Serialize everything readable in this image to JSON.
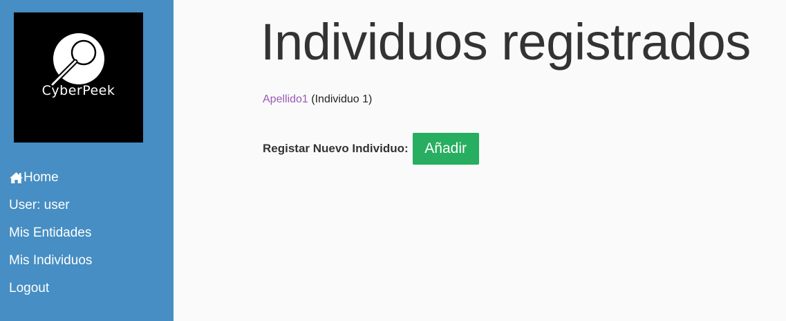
{
  "sidebar": {
    "logo": {
      "text": "CyberPeek",
      "icon": "magnifier-icon"
    },
    "items": [
      {
        "label": "Home",
        "icon": "home-icon"
      },
      {
        "label": "User: user"
      },
      {
        "label": "Mis Entidades"
      },
      {
        "label": "Mis Individuos"
      },
      {
        "label": "Logout"
      }
    ],
    "background": "#468ec3"
  },
  "main": {
    "title": "Individuos registrados",
    "records": [
      {
        "link": "Apellido1",
        "detail": "(Individuo 1)"
      }
    ],
    "register": {
      "label": "Registar Nuevo Individuo:",
      "button": "Añadir",
      "button_color": "#27ae60"
    },
    "link_color": "#9b59b6"
  }
}
